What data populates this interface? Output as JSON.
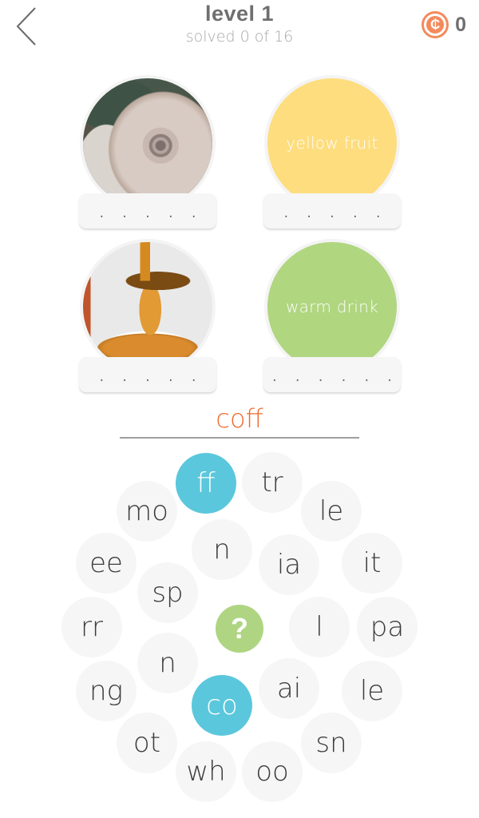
{
  "header": {
    "back_icon": "chevron-left-icon",
    "title": "level 1",
    "subtitle": "solved 0 of 16",
    "coin_icon": "coin-icon",
    "coin_symbol": "₵",
    "coin_count": "0"
  },
  "colors": {
    "accent_orange": "#ef6a2c",
    "coin": "#f48a5c",
    "tile_selected": "#5bc7dc",
    "tile_default": "#f6f6f6",
    "help_button": "#afd582",
    "hint_yellow": "#fedd7f",
    "hint_green": "#b0d680"
  },
  "cards": [
    {
      "type": "photo",
      "image": "frosted snail shell",
      "hint": "",
      "slot_dots": ". . . . ."
    },
    {
      "type": "text",
      "image": "",
      "hint": "yellow fruit",
      "slot_dots": ". . . . ."
    },
    {
      "type": "photo",
      "image": "honey dripping from spoon",
      "hint": "",
      "slot_dots": ". . . . ."
    },
    {
      "type": "text",
      "image": "",
      "hint": "warm drink",
      "slot_dots": ". . . . . ."
    }
  ],
  "answer": {
    "current": "coff"
  },
  "tiles": [
    {
      "label": "ff",
      "selected": true
    },
    {
      "label": "tr",
      "selected": false
    },
    {
      "label": "mo",
      "selected": false
    },
    {
      "label": "le",
      "selected": false
    },
    {
      "label": "ee",
      "selected": false
    },
    {
      "label": "n",
      "selected": false
    },
    {
      "label": "ia",
      "selected": false
    },
    {
      "label": "it",
      "selected": false
    },
    {
      "label": "sp",
      "selected": false
    },
    {
      "label": "rr",
      "selected": false
    },
    {
      "label": "l",
      "selected": false
    },
    {
      "label": "pa",
      "selected": false
    },
    {
      "label": "n",
      "selected": false
    },
    {
      "label": "ng",
      "selected": false
    },
    {
      "label": "ai",
      "selected": false
    },
    {
      "label": "le",
      "selected": false
    },
    {
      "label": "co",
      "selected": true
    },
    {
      "label": "ot",
      "selected": false
    },
    {
      "label": "sn",
      "selected": false
    },
    {
      "label": "wh",
      "selected": false
    },
    {
      "label": "oo",
      "selected": false
    }
  ],
  "help_button": {
    "label": "?",
    "icon": "help-icon"
  }
}
